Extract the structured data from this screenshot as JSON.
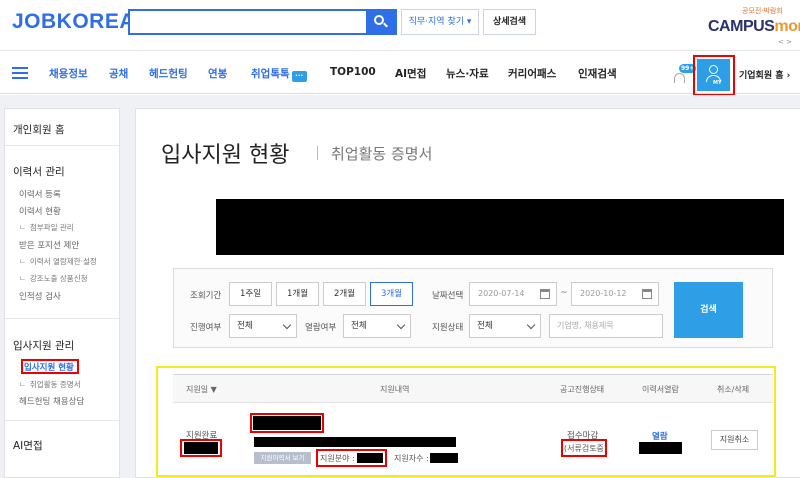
{
  "header": {
    "logo": "JOBKOREA",
    "search_placeholder": "",
    "region_label": "직무·지역 찾기 ▾",
    "detail_label": "상세검색",
    "campus_sub": "공모전·박람회",
    "campus_logo_a": "CAMPUS",
    "campus_logo_b": "mon",
    "campus_arrows": "< >"
  },
  "nav": {
    "items": [
      "채용정보",
      "공채",
      "헤드헌팅",
      "연봉",
      "취업톡톡",
      "TOP100",
      "AI면접",
      "뉴스·자료",
      "커리어패스",
      "인재검색"
    ],
    "chat_badge": "···",
    "bell_badge": "99+",
    "user_caption": "MY",
    "corp_link": "기업회원 홈 ›"
  },
  "sidebar": {
    "home": "개인회원 홈",
    "resume_section": "이력서 관리",
    "resume_items": [
      "이력서 등록",
      "이력서 현황",
      "첨부파일 관리",
      "받은 포지션 제안",
      "이력서 열람제한·설정",
      "강조노출 상품신청",
      "인적성 검사"
    ],
    "apply_section": "입사지원 관리",
    "apply_items": [
      "입사지원 현황",
      "취업활동 증명서",
      "헤드헌팅 채용상담"
    ],
    "ai_section": "AI면접",
    "sub_marker": "ㄴ"
  },
  "main": {
    "title": "입사지원 현황",
    "subtitle": "취업활동 증명서"
  },
  "filter": {
    "period_label": "조회기간",
    "periods": [
      "1주일",
      "1개월",
      "2개월",
      "3개월"
    ],
    "active_period": "3개월",
    "date_label": "날짜선택",
    "date_from": "2020-07-14",
    "date_tilde": "~",
    "date_to": "2020-10-12",
    "progress_label": "진행여부",
    "progress_value": "전체",
    "read_label": "열람여부",
    "read_value": "전체",
    "status_label": "지원상태",
    "status_value": "전체",
    "company_placeholder": "기업명, 채용제목",
    "search_button": "검색"
  },
  "table": {
    "headers": [
      "지원일 ▼",
      "지원내역",
      "공고진행상태",
      "이력서열람",
      "취소/삭제"
    ],
    "row": {
      "status": "지원완료",
      "resume_tag": "지원이력서 보기",
      "field_label": "지원분야 :",
      "applicants_label": "지원자수 :",
      "notice_status": "접수마감",
      "review_status": "(서류검토중)",
      "open_label": "열람",
      "cancel_label": "지원취소"
    }
  }
}
